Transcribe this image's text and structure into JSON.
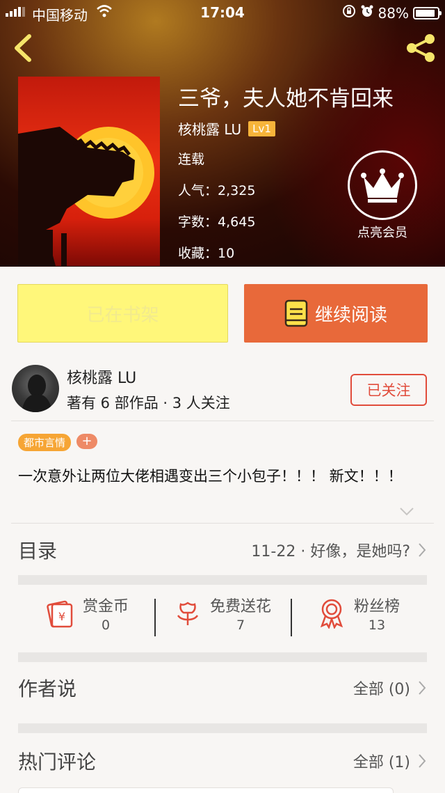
{
  "status_bar": {
    "carrier": "中国移动",
    "time": "17:04",
    "battery": "88%"
  },
  "book": {
    "title": "三爷，夫人她不肯回来",
    "author": "核桃露 LU",
    "level": "Lv1",
    "status": "连载",
    "popularity_label": "人气：",
    "popularity": "2,325",
    "words_label": "字数：",
    "words": "4,645",
    "favorites_label": "收藏：",
    "favorites": "10"
  },
  "vip": {
    "label": "点亮会员"
  },
  "actions": {
    "shelf_label": "已在书架",
    "read_label": "继续阅读"
  },
  "author_card": {
    "name": "核桃露 LU",
    "works": "著有 6 部作品 · 3 人关注",
    "follow_label": "已关注"
  },
  "tags": [
    "都市言情"
  ],
  "tag_add": "+",
  "synopsis": "一次意外让两位大佬相遇变出三个小包子！！！ 新文！！！",
  "catalog": {
    "title": "目录",
    "latest": "11-22 · 好像，是她吗?"
  },
  "stats": [
    {
      "label": "赏金币",
      "value": "0",
      "icon": "red-envelope-icon"
    },
    {
      "label": "免费送花",
      "value": "7",
      "icon": "flower-icon"
    },
    {
      "label": "粉丝榜",
      "value": "13",
      "icon": "award-medal-icon"
    }
  ],
  "author_notes": {
    "title": "作者说",
    "count": "全部 (0)"
  },
  "hot_comments": {
    "title": "热门评论",
    "count": "全部 (1)"
  },
  "colors": {
    "accent_orange": "#e8693a",
    "shelf_yellow": "#fff77a",
    "follow_red": "#e14c3b",
    "tag_orange": "#f6a534"
  }
}
